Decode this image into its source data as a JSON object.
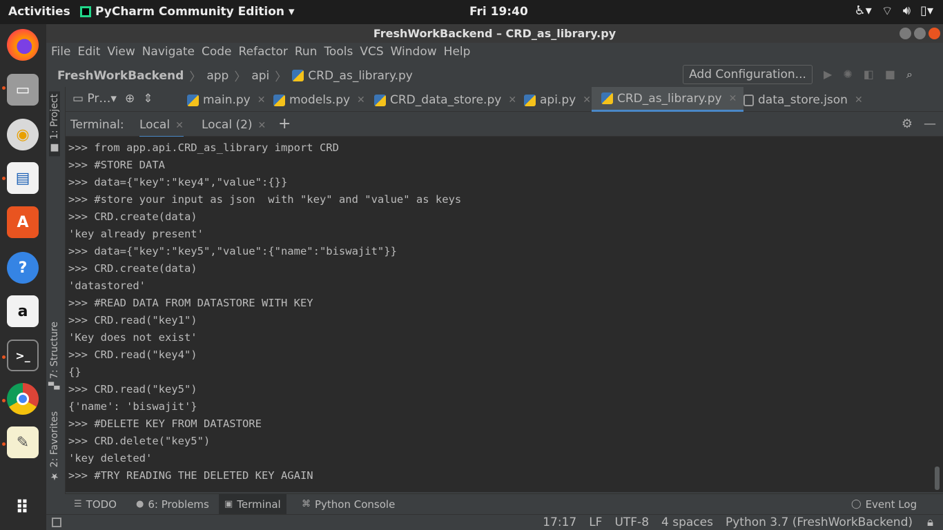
{
  "topbar": {
    "activities": "Activities",
    "app_name": "PyCharm Community Edition",
    "clock": "Fri 19:40"
  },
  "dock": {
    "items": [
      "firefox-icon",
      "files-icon",
      "rhythmbox-icon",
      "writer-icon",
      "software-icon",
      "help-icon",
      "amazon-icon",
      "terminal-icon",
      "chrome-icon",
      "text-editor-icon",
      "show-apps-icon"
    ]
  },
  "window": {
    "title": "FreshWorkBackend – CRD_as_library.py"
  },
  "menu": [
    "File",
    "Edit",
    "View",
    "Navigate",
    "Code",
    "Refactor",
    "Run",
    "Tools",
    "VCS",
    "Window",
    "Help"
  ],
  "navbar": {
    "project": "FreshWorkBackend",
    "crumbs": [
      "app",
      "api"
    ],
    "file": "CRD_as_library.py",
    "add_configuration": "Add Configuration..."
  },
  "left_strip": {
    "project": "1: Project",
    "structure": "7: Structure",
    "favorites": "2: Favorites"
  },
  "tabs": {
    "project_selector": "Pr…",
    "items": [
      "main.py",
      "models.py",
      "CRD_data_store.py",
      "api.py",
      "CRD_as_library.py",
      "data_store.json"
    ],
    "active": "CRD_as_library.py"
  },
  "terminal": {
    "label": "Terminal:",
    "tabs": [
      "Local",
      "Local (2)"
    ],
    "lines": [
      ">>> from app.api.CRD_as_library import CRD",
      ">>> #STORE DATA",
      ">>> data={\"key\":\"key4\",\"value\":{}}",
      ">>> #store your input as json  with \"key\" and \"value\" as keys",
      ">>> CRD.create(data)",
      "'key already present'",
      ">>> data={\"key\":\"key5\",\"value\":{\"name\":\"biswajit\"}}",
      ">>> CRD.create(data)",
      "'datastored'",
      ">>> #READ DATA FROM DATASTORE WITH KEY",
      ">>> CRD.read(\"key1\")",
      "'Key does not exist'",
      ">>> CRD.read(\"key4\")",
      "{}",
      ">>> CRD.read(\"key5\")",
      "{'name': 'biswajit'}",
      ">>> #DELETE KEY FROM DATASTORE",
      ">>> CRD.delete(\"key5\")",
      "'key deleted'",
      ">>> #TRY READING THE DELETED KEY AGAIN"
    ]
  },
  "tool_windows": {
    "todo": "TODO",
    "problems": "6: Problems",
    "terminal": "Terminal",
    "python_console": "Python Console",
    "event_log": "Event Log"
  },
  "status": {
    "position": "17:17",
    "line_sep": "LF",
    "encoding": "UTF-8",
    "indent": "4 spaces",
    "interpreter": "Python 3.7 (FreshWorkBackend)"
  }
}
